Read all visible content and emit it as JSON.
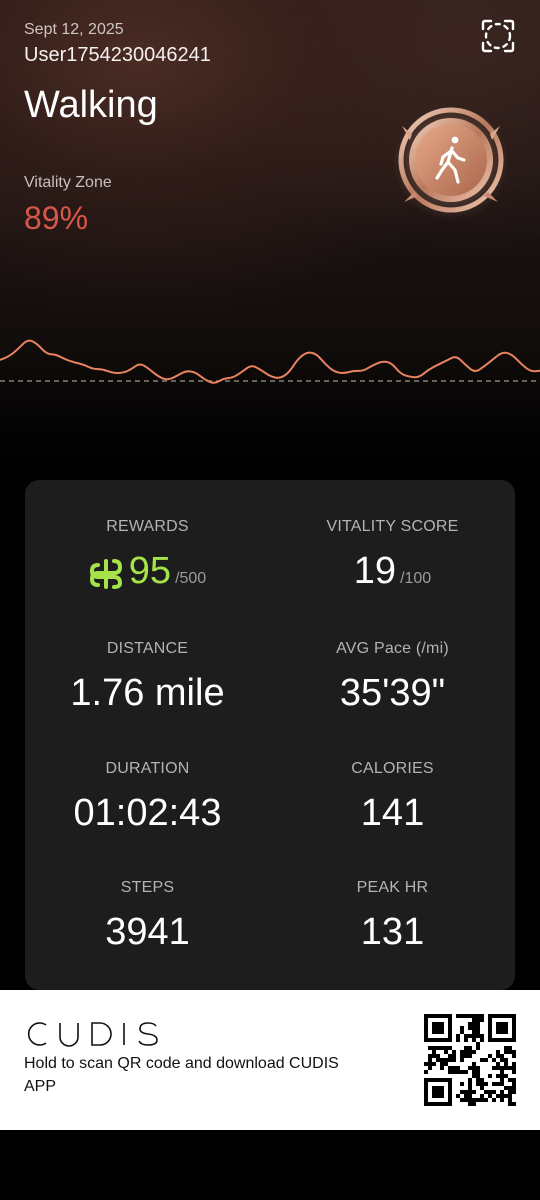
{
  "header": {
    "date": "Sept 12, 2025",
    "username": "User1754230046241",
    "activity": "Walking",
    "vitality_zone_label": "Vitality Zone",
    "vitality_zone_value": "89%"
  },
  "colors": {
    "accent_green": "#a6e34a",
    "zone_red": "#d8574a",
    "heart_rate_line": "#e8835f",
    "badge_copper": "#c98a6c"
  },
  "stats": {
    "rewards": {
      "label": "REWARDS",
      "value": "95",
      "suffix": "/500",
      "icon": "rewards-token-icon"
    },
    "vitality_score": {
      "label": "VITALITY SCORE",
      "value": "19",
      "suffix": "/100"
    },
    "distance": {
      "label": "DISTANCE",
      "value": "1.76 mile"
    },
    "avg_pace": {
      "label": "AVG Pace (/mi)",
      "value": "35'39\""
    },
    "duration": {
      "label": "DURATION",
      "value": "01:02:43"
    },
    "calories": {
      "label": "CALORIES",
      "value": "141"
    },
    "steps": {
      "label": "STEPS",
      "value": "3941"
    },
    "peak_hr": {
      "label": "PEAK HR",
      "value": "131"
    }
  },
  "footer": {
    "brand": "CUDIS",
    "cta": "Hold to scan QR code and download CUDIS APP"
  },
  "icons": [
    "share-icon",
    "walking-badge-icon",
    "rewards-token-icon",
    "qr-code"
  ]
}
